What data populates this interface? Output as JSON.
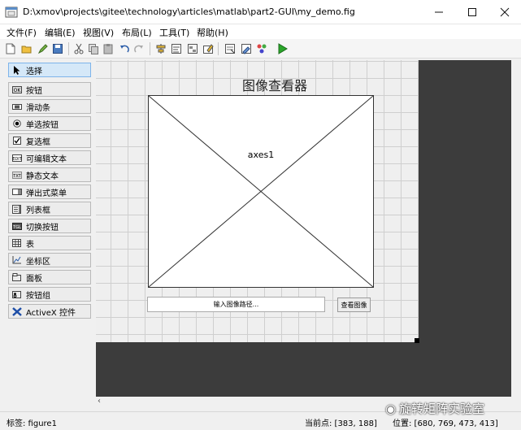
{
  "window": {
    "title": "D:\\xmov\\projects\\gitee\\technology\\articles\\matlab\\part2-GUI\\my_demo.fig",
    "icon": "matlab-guide-icon"
  },
  "menu": {
    "items": [
      "文件(F)",
      "编辑(E)",
      "视图(V)",
      "布局(L)",
      "工具(T)",
      "帮助(H)"
    ]
  },
  "toolbar": {
    "icons": [
      "new-icon",
      "open-icon",
      "save-icon",
      "cut-icon",
      "copy-icon",
      "paste-icon",
      "undo-icon",
      "redo-icon",
      "align-icon",
      "menu-editor-icon",
      "tab-order-icon",
      "toolbar-editor-icon",
      "editor-icon",
      "property-inspector-icon",
      "object-browser-icon",
      "run-icon"
    ]
  },
  "palette": {
    "items": [
      {
        "label": "选择",
        "icon": "arrow-icon",
        "selected": true
      },
      {
        "label": "按钮",
        "icon": "pushbutton-icon"
      },
      {
        "label": "滑动条",
        "icon": "slider-icon"
      },
      {
        "label": "单选按钮",
        "icon": "radio-icon"
      },
      {
        "label": "复选框",
        "icon": "checkbox-icon"
      },
      {
        "label": "可编辑文本",
        "icon": "edit-text-icon"
      },
      {
        "label": "静态文本",
        "icon": "static-text-icon"
      },
      {
        "label": "弹出式菜单",
        "icon": "popup-icon"
      },
      {
        "label": "列表框",
        "icon": "listbox-icon"
      },
      {
        "label": "切换按钮",
        "icon": "toggle-icon"
      },
      {
        "label": "表",
        "icon": "table-icon"
      },
      {
        "label": "坐标区",
        "icon": "axes-icon"
      },
      {
        "label": "面板",
        "icon": "panel-icon"
      },
      {
        "label": "按钮组",
        "icon": "button-group-icon"
      },
      {
        "label": "ActiveX 控件",
        "icon": "activex-icon"
      }
    ]
  },
  "figure": {
    "title_text": "图像查看器",
    "axes_label": "axes1",
    "edit_placeholder": "输入图像路径...",
    "button_label": "查看图像"
  },
  "status": {
    "tag": "标签: figure1",
    "current_point": "当前点: [383, 188]",
    "position": "位置: [680, 769, 473, 413]"
  },
  "watermark": {
    "text": "旋转矩阵实验室"
  }
}
